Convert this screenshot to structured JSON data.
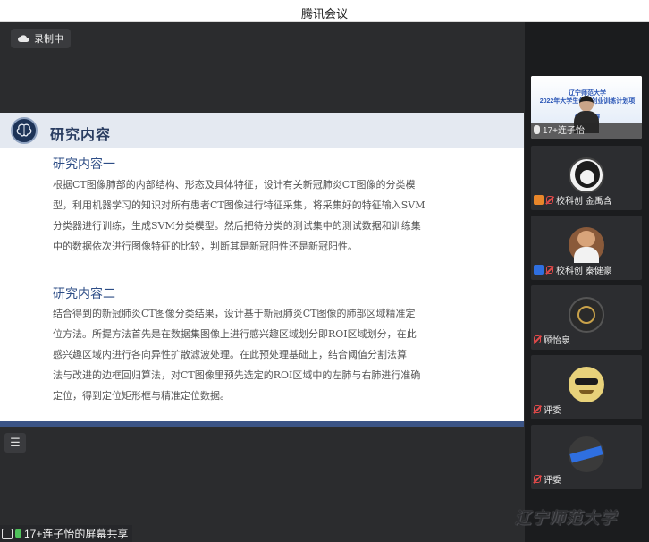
{
  "window": {
    "title": "腾讯会议"
  },
  "recording": {
    "label": "录制中"
  },
  "slide": {
    "title": "研究内容",
    "sections": [
      {
        "heading": "研究内容一",
        "lines": [
          "根据CT图像肺部的内部结构、形态及具体特征，设计有关新冠肺炎CT图像的分类模",
          "型，利用机器学习的知识对所有患者CT图像进行特征采集，将采集好的特征输入SVM",
          "分类器进行训练，生成SVM分类模型。然后把待分类的测试集中的测试数据和训练集",
          "中的数据依次进行图像特征的比较，判断其是新冠阴性还是新冠阳性。"
        ]
      },
      {
        "heading": "研究内容二",
        "lines": [
          "结合得到的新冠肺炎CT图像分类结果，设计基于新冠肺炎CT图像的肺部区域精准定",
          "位方法。所提方法首先是在数据集图像上进行感兴趣区域划分即ROI区域划分，在此",
          "感兴趣区域内进行各向异性扩散滤波处理。在此预处理基础上，结合阈值分割法算",
          "法与改进的边框回归算法，对CT图像里预先选定的ROI区域中的左肺与右肺进行准确",
          "定位，得到定位矩形框与精准定位数据。"
        ]
      }
    ]
  },
  "share_bar": {
    "label": "17+连子怡的屏幕共享"
  },
  "participants": [
    {
      "name": "17+连子怡",
      "banner": [
        "辽宁师范大学",
        "2022年大学生创新创业训练计划项目",
        "结题答辩"
      ]
    },
    {
      "name": "校科创 金禹含",
      "badge_color": "#e8862a"
    },
    {
      "name": "校科创 秦健豪",
      "badge_color": "#2f6fe0"
    },
    {
      "name": "顾怡泉"
    },
    {
      "name": "评委"
    },
    {
      "name": "评委"
    }
  ],
  "watermark": {
    "text": "辽宁师范大学"
  },
  "colors": {
    "accent": "#2a3d61",
    "slide_foot": "#3b5486",
    "mic_on": "#4fc25b",
    "mic_off": "#e24a4a"
  }
}
